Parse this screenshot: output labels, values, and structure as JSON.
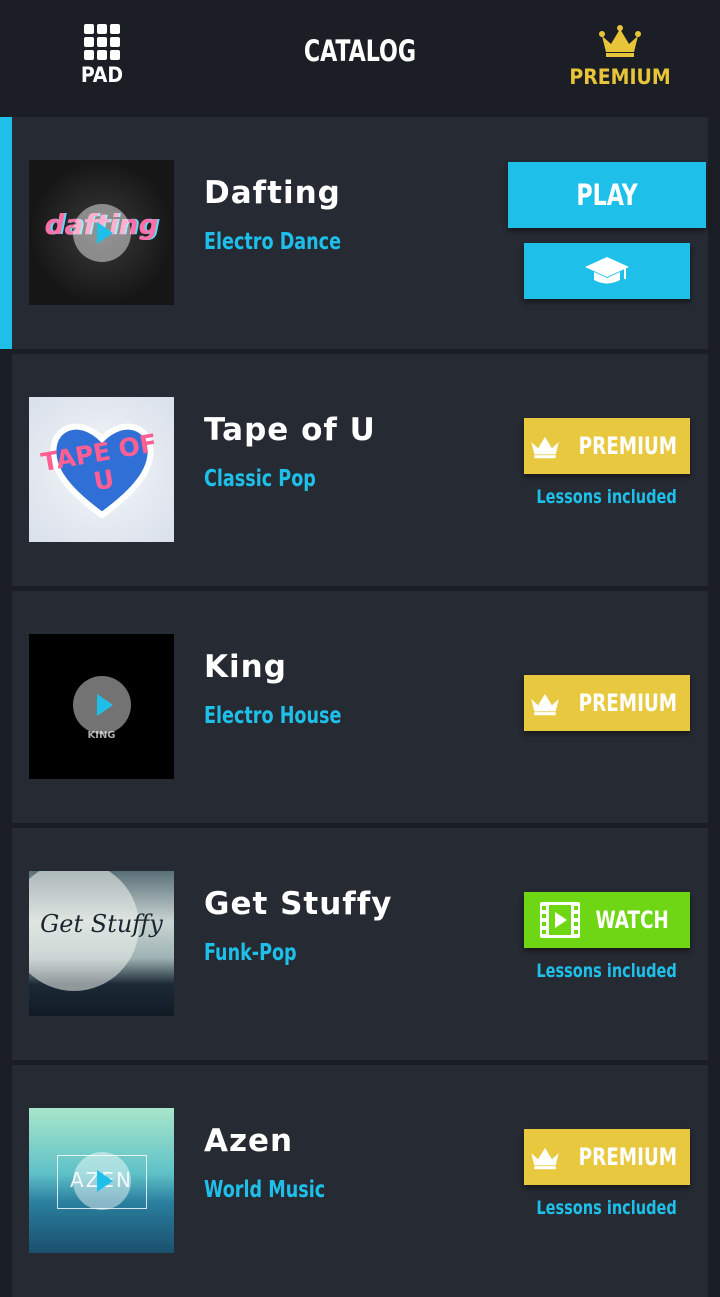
{
  "header": {
    "left_label": "PAD",
    "title": "CATALOG",
    "right_label": "PREMIUM",
    "left_icon": "grid-icon",
    "right_icon": "crown-icon"
  },
  "colors": {
    "background": "#1b1f25",
    "card": "#262a32",
    "accent": "#1ec0ea",
    "premium": "#e8c83f",
    "watch": "#6fd614"
  },
  "songs": [
    {
      "title": "Dafting",
      "genre": "Electro Dance",
      "cover_text": "dafting",
      "action": "play",
      "play_label": "PLAY",
      "learn_icon": "graduation-cap-icon",
      "selected": true
    },
    {
      "title": "Tape of U",
      "genre": "Classic Pop",
      "cover_text": "TAPE OF U",
      "action": "premium",
      "button_label": "PREMIUM",
      "note": "Lessons included"
    },
    {
      "title": "King",
      "genre": "Electro House",
      "cover_text": "KING",
      "action": "premium",
      "button_label": "PREMIUM"
    },
    {
      "title": "Get Stuffy",
      "genre": "Funk-Pop",
      "cover_text": "Get Stuffy",
      "action": "watch",
      "button_label": "WATCH",
      "note": "Lessons included"
    },
    {
      "title": "Azen",
      "genre": "World Music",
      "cover_text": "AZEN",
      "action": "premium",
      "button_label": "PREMIUM",
      "note": "Lessons included"
    }
  ]
}
